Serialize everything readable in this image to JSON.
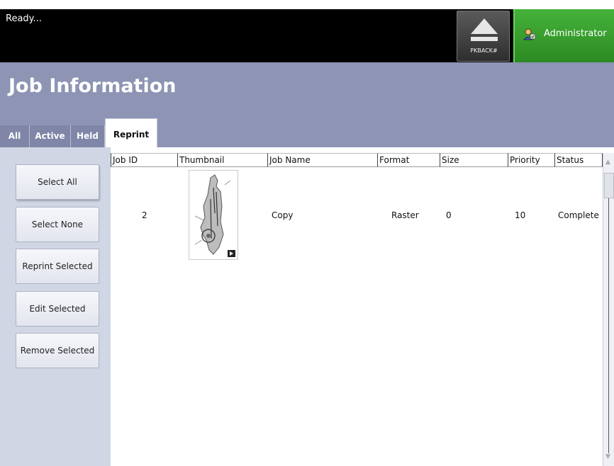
{
  "status": {
    "text": "Ready..."
  },
  "top_buttons": {
    "pkback_label": "PKBACK#",
    "admin_label": "Administrator"
  },
  "header": {
    "title": "Job Information"
  },
  "tabs": [
    {
      "label": "All"
    },
    {
      "label": "Active"
    },
    {
      "label": "Held"
    },
    {
      "label": "Reprint"
    }
  ],
  "actions": {
    "select_all": "Select All",
    "select_none": "Select None",
    "reprint_selected": "Reprint Selected",
    "edit_selected": "Edit Selected",
    "remove_selected": "Remove Selected"
  },
  "table": {
    "columns": [
      "Job ID",
      "Thumbnail",
      "Job Name",
      "Format",
      "Size",
      "Priority",
      "Status"
    ],
    "rows": [
      {
        "job_id": "2",
        "job_name": "Copy",
        "format": "Raster",
        "size": "0",
        "priority": "10",
        "status": "Complete"
      }
    ]
  },
  "colors": {
    "header_bg": "#8d94b4",
    "admin_bg": "#3aa02f",
    "panel_bg": "#d1d6e4"
  },
  "icons": {
    "eject": "eject-icon",
    "admin": "admin-user-icon",
    "thumb_badge": "preview-arrow-icon"
  }
}
